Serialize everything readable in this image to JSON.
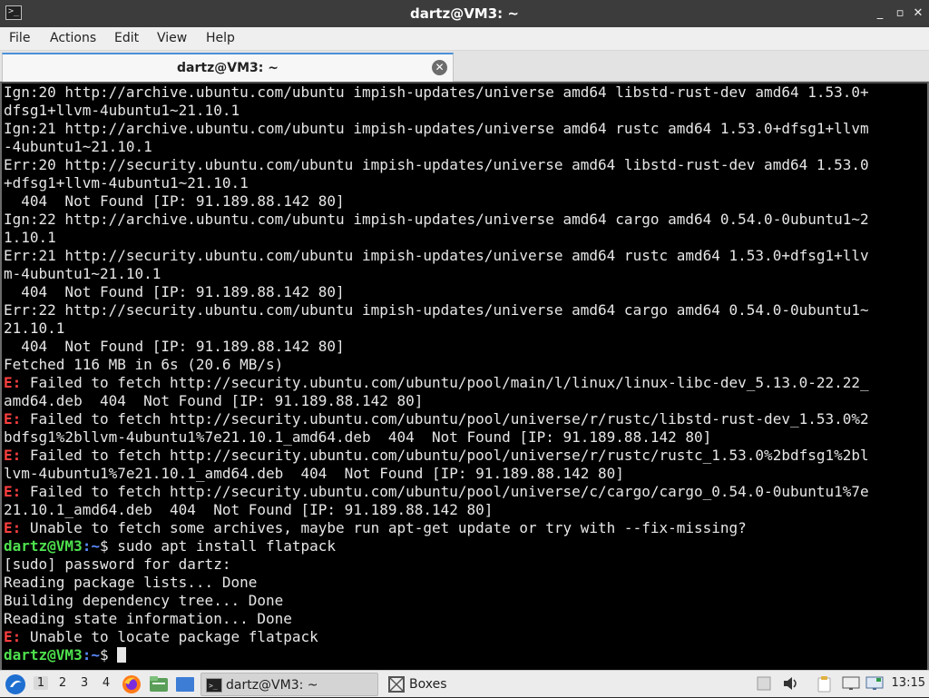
{
  "window": {
    "title": "dartz@VM3: ~",
    "minimize_glyph": "_",
    "maximize_glyph": "▫",
    "close_glyph": "✕"
  },
  "menu": {
    "file": "File",
    "actions": "Actions",
    "edit": "Edit",
    "view": "View",
    "help": "Help"
  },
  "tab": {
    "label": "dartz@VM3: ~",
    "close_glyph": "✕"
  },
  "terminal": {
    "lines": [
      {
        "text": "Ign:20 http://archive.ubuntu.com/ubuntu impish-updates/universe amd64 libstd-rust-dev amd64 1.53.0+"
      },
      {
        "text": "dfsg1+llvm-4ubuntu1~21.10.1"
      },
      {
        "text": "Ign:21 http://archive.ubuntu.com/ubuntu impish-updates/universe amd64 rustc amd64 1.53.0+dfsg1+llvm"
      },
      {
        "text": "-4ubuntu1~21.10.1"
      },
      {
        "text": "Err:20 http://security.ubuntu.com/ubuntu impish-updates/universe amd64 libstd-rust-dev amd64 1.53.0"
      },
      {
        "text": "+dfsg1+llvm-4ubuntu1~21.10.1"
      },
      {
        "text": "  404  Not Found [IP: 91.189.88.142 80]"
      },
      {
        "text": "Ign:22 http://archive.ubuntu.com/ubuntu impish-updates/universe amd64 cargo amd64 0.54.0-0ubuntu1~2"
      },
      {
        "text": "1.10.1"
      },
      {
        "text": "Err:21 http://security.ubuntu.com/ubuntu impish-updates/universe amd64 rustc amd64 1.53.0+dfsg1+llv"
      },
      {
        "text": "m-4ubuntu1~21.10.1"
      },
      {
        "text": "  404  Not Found [IP: 91.189.88.142 80]"
      },
      {
        "text": "Err:22 http://security.ubuntu.com/ubuntu impish-updates/universe amd64 cargo amd64 0.54.0-0ubuntu1~"
      },
      {
        "text": "21.10.1"
      },
      {
        "text": "  404  Not Found [IP: 91.189.88.142 80]"
      },
      {
        "text": "Fetched 116 MB in 6s (20.6 MB/s)"
      },
      {
        "err": "E:",
        "text": " Failed to fetch http://security.ubuntu.com/ubuntu/pool/main/l/linux/linux-libc-dev_5.13.0-22.22_"
      },
      {
        "text": "amd64.deb  404  Not Found [IP: 91.189.88.142 80]"
      },
      {
        "err": "E:",
        "text": " Failed to fetch http://security.ubuntu.com/ubuntu/pool/universe/r/rustc/libstd-rust-dev_1.53.0%2"
      },
      {
        "text": "bdfsg1%2bllvm-4ubuntu1%7e21.10.1_amd64.deb  404  Not Found [IP: 91.189.88.142 80]"
      },
      {
        "err": "E:",
        "text": " Failed to fetch http://security.ubuntu.com/ubuntu/pool/universe/r/rustc/rustc_1.53.0%2bdfsg1%2bl"
      },
      {
        "text": "lvm-4ubuntu1%7e21.10.1_amd64.deb  404  Not Found [IP: 91.189.88.142 80]"
      },
      {
        "err": "E:",
        "text": " Failed to fetch http://security.ubuntu.com/ubuntu/pool/universe/c/cargo/cargo_0.54.0-0ubuntu1%7e"
      },
      {
        "text": "21.10.1_amd64.deb  404  Not Found [IP: 91.189.88.142 80]"
      },
      {
        "err": "E:",
        "text": " Unable to fetch some archives, maybe run apt-get update or try with --fix-missing?"
      },
      {
        "prompt": "dartz@VM3",
        "cwd": ":~",
        "text": "$ sudo apt install flatpack"
      },
      {
        "text": "[sudo] password for dartz:"
      },
      {
        "text": "Reading package lists... Done"
      },
      {
        "text": "Building dependency tree... Done"
      },
      {
        "text": "Reading state information... Done"
      },
      {
        "err": "E:",
        "text": " Unable to locate package flatpack"
      },
      {
        "prompt": "dartz@VM3",
        "cwd": ":~",
        "text": "$ ",
        "cursor": true
      }
    ]
  },
  "taskbar": {
    "workspaces": [
      "1",
      "2",
      "3",
      "4"
    ],
    "active_workspace": "1",
    "terminal_task": "dartz@VM3: ~",
    "boxes_task": "Boxes",
    "clock": "13:15"
  }
}
